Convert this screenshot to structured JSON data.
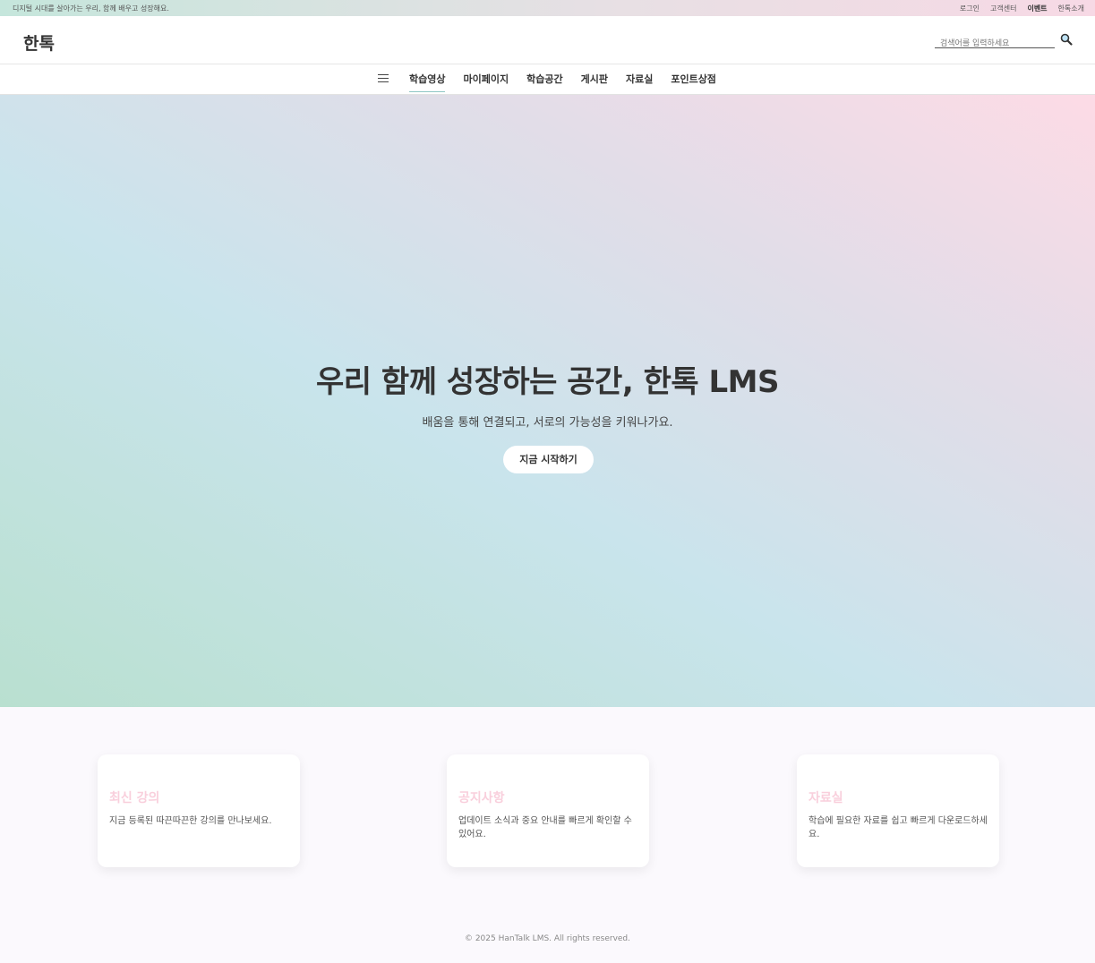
{
  "topbar": {
    "tagline": "디지털 시대를 살아가는 우리, 함께 배우고 성장해요.",
    "links": [
      "로그인",
      "고객센터",
      "이벤트",
      "한톡소개"
    ]
  },
  "header": {
    "logo": "한톡",
    "search_placeholder": "검색어를 입력하세요",
    "search_icon": "magnifier-icon"
  },
  "nav": {
    "menu_icon": "hamburger-icon",
    "items": [
      "학습영상",
      "마이페이지",
      "학습공간",
      "게시판",
      "자료실",
      "포인트상점"
    ],
    "active_item": "학습영상"
  },
  "hero": {
    "title": "우리 함께 성장하는 공간, 한톡 LMS",
    "subtitle": "배움을 통해 연결되고, 서로의 가능성을 키워나가요.",
    "cta": "지금 시작하기"
  },
  "cards": [
    {
      "title": "최신 강의",
      "desc": "지금 등록된 따끈따끈한 강의를 만나보세요."
    },
    {
      "title": "공지사항",
      "desc": "업데이트 소식과 중요 안내를 빠르게 확인할 수 있어요."
    },
    {
      "title": "자료실",
      "desc": "학습에 필요한 자료를 쉽고 빠르게 다운로드하세요."
    }
  ],
  "footer": {
    "copyright": "© 2025 HanTalk LMS. All rights reserved."
  },
  "colors": {
    "card_title": "#f9cfdc",
    "hero_gradient_start": "#b9e0d0",
    "hero_gradient_end": "#fddbe6",
    "nav_active_underline": "#8fc7c4"
  }
}
